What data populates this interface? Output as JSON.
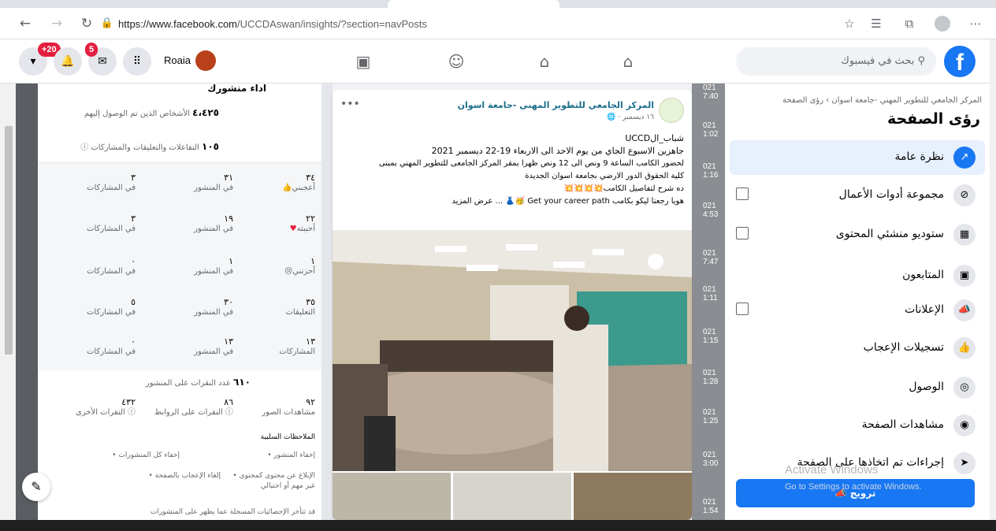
{
  "browser": {
    "url_host": "https://www.facebook.com",
    "url_path": "/UCCDAswan/insights/?section=navPosts"
  },
  "topbar": {
    "search_placeholder": "بحث في فيسبوك",
    "user_name": "Roaia",
    "notifications_badge": "5",
    "menu_badge": "+20"
  },
  "sidebar": {
    "breadcrumb": "المركز الجامعي للتطوير المهني -جامعة اسوان › رؤى الصفحة",
    "title": "رؤى الصفحة",
    "items": [
      {
        "label": "نظرة عامة",
        "icon": "chart-icon"
      },
      {
        "label": "مجموعة أدوات الأعمال",
        "icon": "business-icon"
      },
      {
        "label": "ستوديو منشئي المحتوى",
        "icon": "studio-icon"
      },
      {
        "label": "المتابعون",
        "icon": "followers-icon"
      },
      {
        "label": "الإعلانات",
        "icon": "megaphone-icon"
      },
      {
        "label": "تسجيلات الإعجاب",
        "icon": "thumbs-up-icon"
      },
      {
        "label": "الوصول",
        "icon": "reach-icon"
      },
      {
        "label": "مشاهدات الصفحة",
        "icon": "eye-icon"
      },
      {
        "label": "إجراءات تم اتخاذها على الصفحة",
        "icon": "cursor-icon"
      }
    ],
    "promote_label": "ترويج"
  },
  "overlay": {
    "activate_title": "Activate Windows",
    "activate_sub": "Go to Settings to activate Windows."
  },
  "post": {
    "page_name": "المركز الجامعي للتطوير المهني -جامعة اسوان",
    "date": "١٦ ديسمبر ·",
    "lines": [
      "شباب_الUCCD",
      "جاهزين الاسبوع الجاي من يوم الاحد الى الاربعاء 19-22 ديسمبر 2021",
      "لحضور الكامب الساعة 9 ونص الى 12 ونص ظهرا بمقر المركز الجامعى للتطوير المهني بمبنى",
      "كلية الحقوق الدور الارضي بجامعة اسوان الجديدة",
      "ده شرح لتفاصيل الكامب💥💥💥💥",
      "هويا رجعنا ليكو بكامب Get your career path 🥳👗 ... عرض المزيد"
    ]
  },
  "stats": {
    "section_title": "اداء منشورك",
    "people_reached": {
      "value": "٤،٤٢٥",
      "label": "الأشخاص الذين تم الوصول إليهم"
    },
    "engagements": {
      "value": "١٠٥",
      "label": "التفاعلات والتعليقات والمشاركات"
    },
    "reaction_rows": [
      {
        "total": "٣٤",
        "name": "أعجبني",
        "post": "٣١",
        "shares": "٣"
      },
      {
        "total": "٢٢",
        "name": "أحببته",
        "post": "١٩",
        "shares": "٣"
      },
      {
        "total": "١",
        "name": "أحزنني",
        "post": "١",
        "shares": "٠"
      },
      {
        "total": "٣٥",
        "name": "التعليقات",
        "post": "٣٠",
        "shares": "٥"
      },
      {
        "total": "١٣",
        "name": "المشاركات",
        "post": "١٣",
        "shares": "٠"
      }
    ],
    "col_post": "في المنشور",
    "col_shares": "في المشاركات",
    "clicks": {
      "value": "٦١٠",
      "label": "عدد النقرات على المنشور"
    },
    "click_cells": [
      {
        "value": "٩٢",
        "label": "مشاهدات الصور"
      },
      {
        "value": "٨٦",
        "label": "النقرات على الروابط"
      },
      {
        "value": "٤٣٢",
        "label": "النقرات الأخرى"
      }
    ],
    "negative_title": "الملاحظات السلبية",
    "negative_items": [
      "• إخفاء المنشور",
      "• إخفاء كل المنشورات",
      "• الإبلاغ عن محتوى كمحتوى غير مهم أو احتيالي",
      "• إلغاء الإعجاب بالصفحة"
    ],
    "footnote": "قد تتأخر الإحصائيات المسجلة عما يظهر على المنشورات"
  },
  "date_column": [
    "021",
    "7:40",
    "021",
    "1:02",
    "021",
    "1:16",
    "021",
    "4:53",
    "021",
    "7:47",
    "021",
    "1:11",
    "021",
    "1:15",
    "021",
    "1:28",
    "021",
    "1:25",
    "021",
    "3:00",
    "021",
    "1:54"
  ]
}
